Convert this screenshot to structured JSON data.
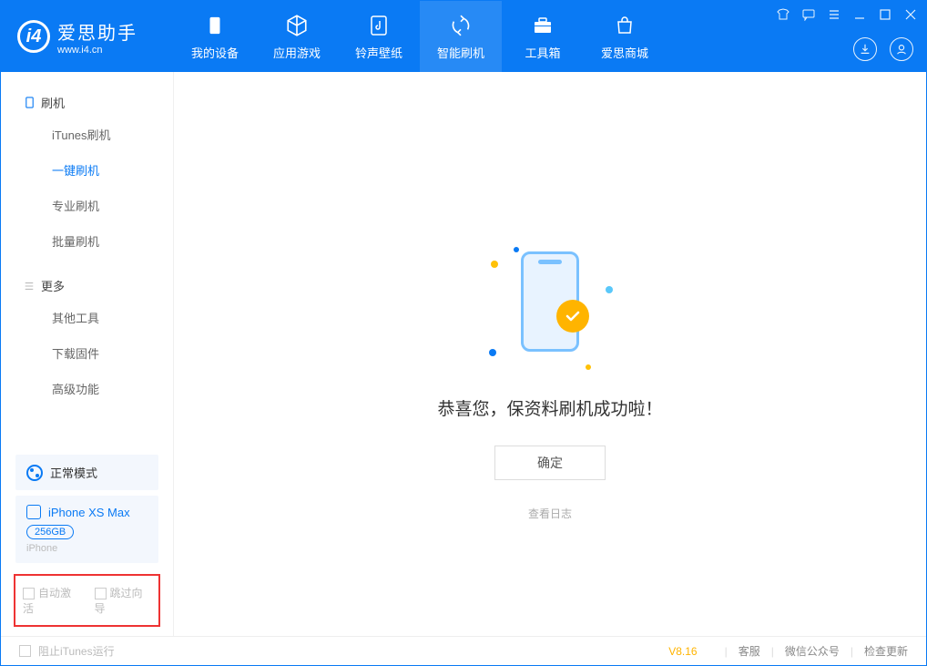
{
  "app": {
    "title": "爱思助手",
    "subtitle": "www.i4.cn"
  },
  "nav": {
    "items": [
      {
        "label": "我的设备",
        "icon": "device"
      },
      {
        "label": "应用游戏",
        "icon": "cube"
      },
      {
        "label": "铃声壁纸",
        "icon": "music"
      },
      {
        "label": "智能刷机",
        "icon": "refresh",
        "active": true
      },
      {
        "label": "工具箱",
        "icon": "toolbox"
      },
      {
        "label": "爱思商城",
        "icon": "bag"
      }
    ]
  },
  "sidebar": {
    "section1_title": "刷机",
    "section1_items": [
      {
        "label": "iTunes刷机"
      },
      {
        "label": "一键刷机",
        "selected": true
      },
      {
        "label": "专业刷机"
      },
      {
        "label": "批量刷机"
      }
    ],
    "section2_title": "更多",
    "section2_items": [
      {
        "label": "其他工具"
      },
      {
        "label": "下载固件"
      },
      {
        "label": "高级功能"
      }
    ],
    "status_label": "正常模式",
    "device": {
      "name": "iPhone XS Max",
      "storage": "256GB",
      "type": "iPhone"
    },
    "cb_auto_activate": "自动激活",
    "cb_skip_guide": "跳过向导"
  },
  "main": {
    "success_message": "恭喜您，保资料刷机成功啦！",
    "ok_button": "确定",
    "view_log": "查看日志"
  },
  "footer": {
    "block_itunes": "阻止iTunes运行",
    "version": "V8.16",
    "support": "客服",
    "wechat": "微信公众号",
    "check_update": "检查更新"
  }
}
